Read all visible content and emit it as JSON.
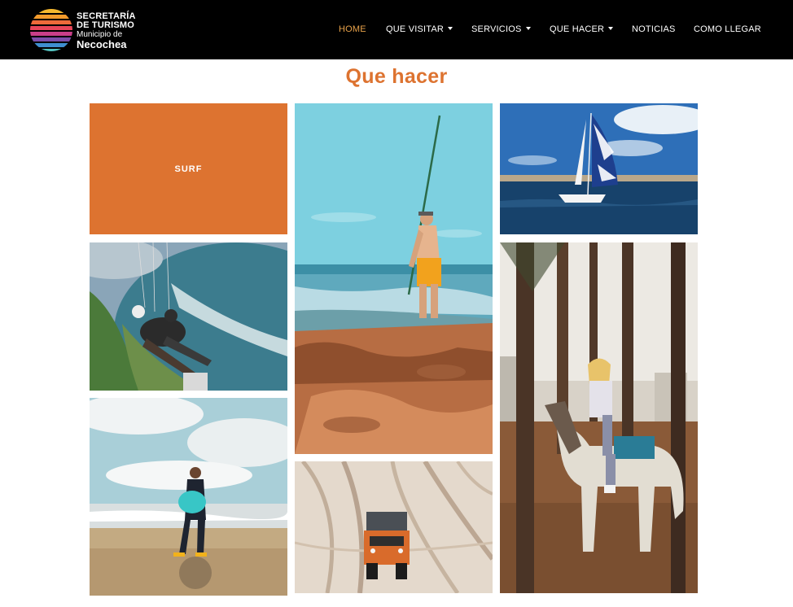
{
  "header": {
    "logo": {
      "line1": "SECRETARÍA",
      "line2": "DE TURISMO",
      "line3": "Municipio de",
      "line4": "Necochea"
    },
    "nav": [
      {
        "label": "HOME",
        "active": true,
        "has_dropdown": false
      },
      {
        "label": "QUE VISITAR",
        "active": false,
        "has_dropdown": true
      },
      {
        "label": "SERVICIOS",
        "active": false,
        "has_dropdown": true
      },
      {
        "label": "QUE HACER",
        "active": false,
        "has_dropdown": true
      },
      {
        "label": "NOTICIAS",
        "active": false,
        "has_dropdown": false
      },
      {
        "label": "COMO LLEGAR",
        "active": false,
        "has_dropdown": false
      }
    ]
  },
  "main": {
    "title": "Que hacer",
    "tiles": [
      {
        "label": "SURF"
      }
    ]
  },
  "colors": {
    "accent": "#dd7330",
    "nav_active": "#e8a24a",
    "header_bg": "#000000"
  }
}
